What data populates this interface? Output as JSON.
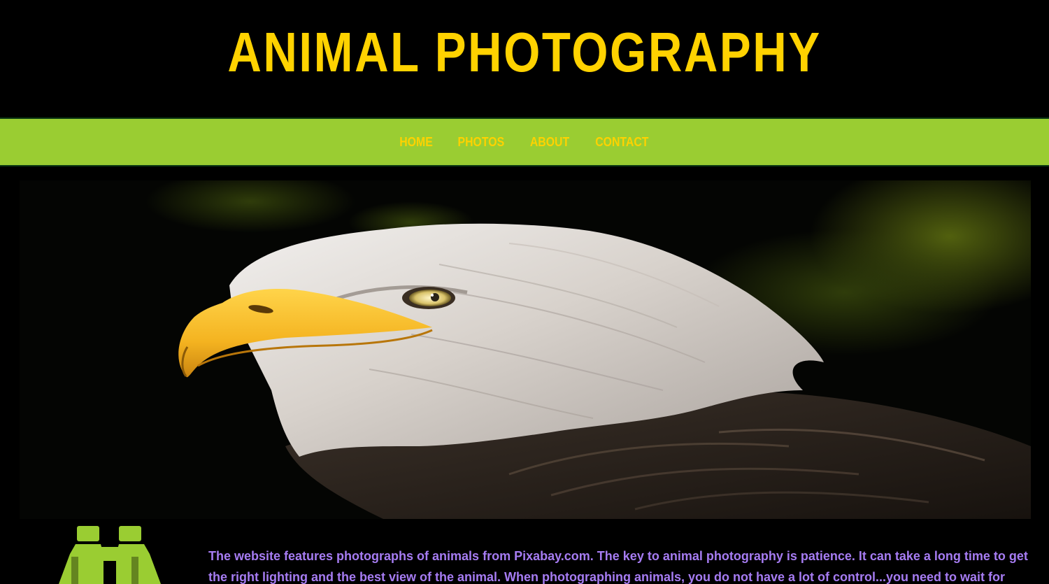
{
  "header": {
    "title": "ANIMAL PHOTOGRAPHY"
  },
  "nav": {
    "items": [
      {
        "label": "HOME"
      },
      {
        "label": "PHOTOS"
      },
      {
        "label": "ABOUT"
      },
      {
        "label": "CONTACT"
      }
    ]
  },
  "hero": {
    "subject": "bald eagle"
  },
  "content": {
    "icon": "binoculars-icon",
    "intro": "The website features photographs of animals from Pixabay.com. The key to animal photography is patience. It can take a long time to get the right lighting and the best view of the animal. When photographing animals, you do not have a lot of control...you need to wait for them."
  },
  "colors": {
    "background": "#000000",
    "title": "#ffd200",
    "nav_bar": "#9acd32",
    "nav_text": "#ffd200",
    "intro_text": "#a67cf2",
    "icon": "#9acd32"
  }
}
